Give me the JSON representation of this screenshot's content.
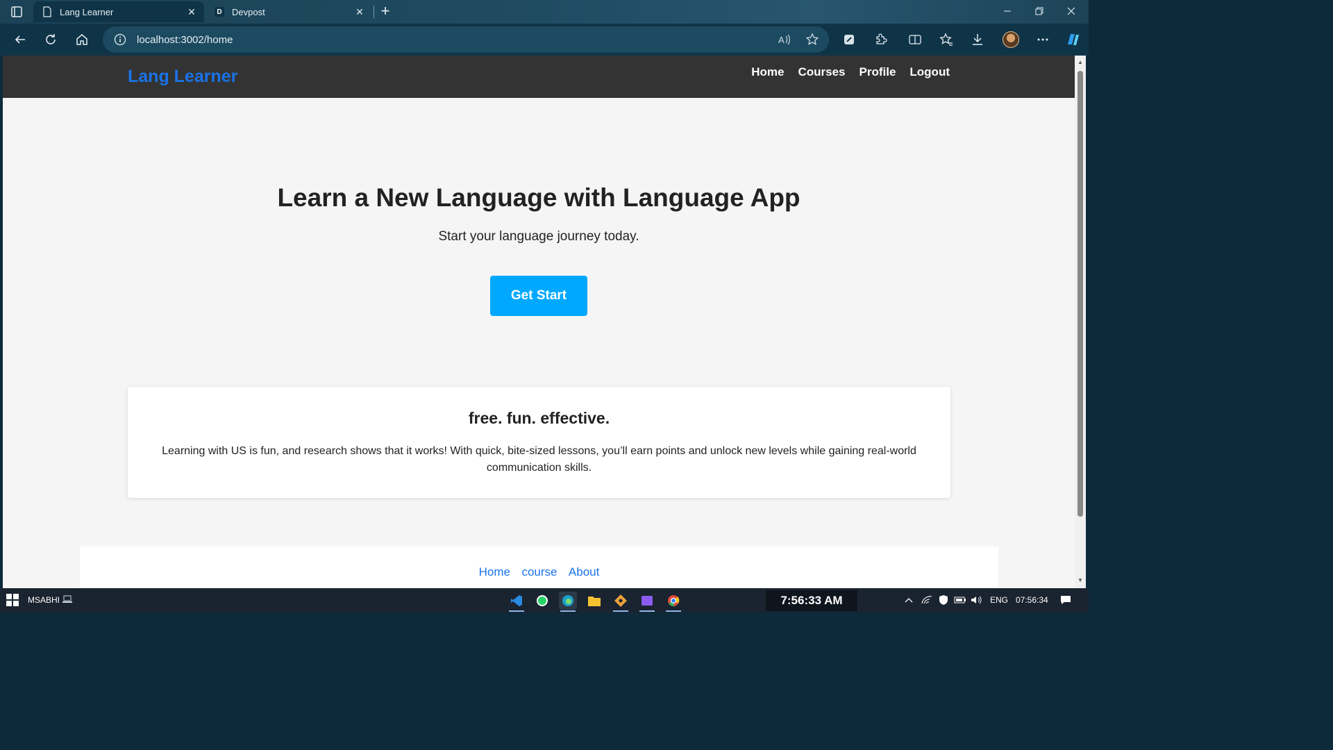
{
  "browser": {
    "tabs": [
      {
        "title": "Lang Learner",
        "active": true
      },
      {
        "title": "Devpost",
        "active": false,
        "badge": "D"
      }
    ],
    "url": "localhost:3002/home",
    "new_tab_symbol": "+"
  },
  "site": {
    "brand": "Lang Learner",
    "nav": [
      "Home",
      "Courses",
      "Profile",
      "Logout"
    ],
    "hero": {
      "title": "Learn a New Language with Language App",
      "subtitle": "Start your language journey today.",
      "cta": "Get Start"
    },
    "card": {
      "title": "free. fun. effective.",
      "text": "Learning with US is fun, and research shows that it works! With quick, bite-sized lessons, you’ll earn points and unlock new levels while gaining real-world communication skills."
    },
    "footer_links": [
      "Home",
      "course",
      "About"
    ]
  },
  "taskbar": {
    "user": "MSABHI",
    "clock_widget": "7:56:33 AM",
    "language": "ENG",
    "time": "07:56:34"
  },
  "colors": {
    "brand": "#1a73e8",
    "navbar": "#333333",
    "cta": "#00a8ff",
    "page_bg": "#f5f5f5"
  }
}
